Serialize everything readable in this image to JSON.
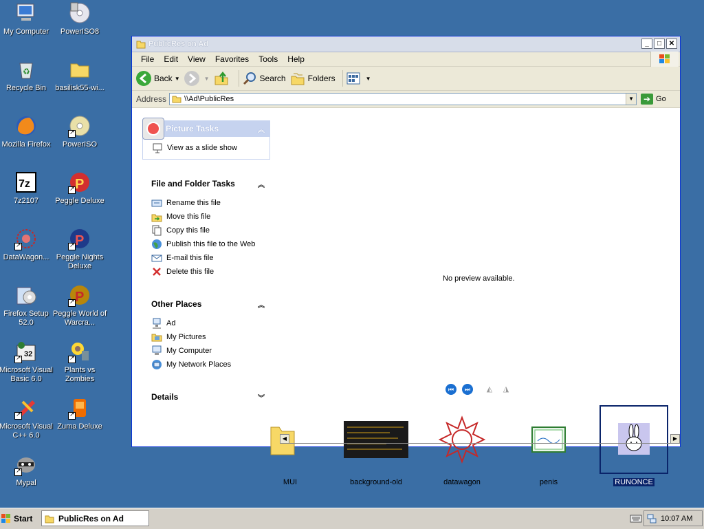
{
  "desktop": {
    "icons": [
      {
        "label": "My Computer",
        "icon": "my-computer-icon"
      },
      {
        "label": "PowerISO8",
        "icon": "poweriso-icon"
      },
      {
        "label": "Recycle Bin",
        "icon": "recycle-bin-icon"
      },
      {
        "label": "basilisk55-wi...",
        "icon": "folder-icon"
      },
      {
        "label": "Mozilla Firefox",
        "icon": "firefox-icon"
      },
      {
        "label": "PowerISO",
        "icon": "poweriso-icon"
      },
      {
        "label": "7z2107",
        "icon": "7zip-icon"
      },
      {
        "label": "Peggle Deluxe",
        "icon": "peggle-icon"
      },
      {
        "label": "DataWagon...",
        "icon": "datawagon-icon"
      },
      {
        "label": "Peggle Nights Deluxe",
        "icon": "peggle-icon"
      },
      {
        "label": "Firefox Setup 52.0",
        "icon": "setup-icon"
      },
      {
        "label": "Peggle World of Warcra...",
        "icon": "peggle-icon"
      },
      {
        "label": "Microsoft Visual Basic 6.0",
        "icon": "vb-icon"
      },
      {
        "label": "Plants vs Zombies",
        "icon": "pvz-icon"
      },
      {
        "label": "Microsoft Visual C++ 6.0",
        "icon": "vc-icon"
      },
      {
        "label": "Zuma Deluxe",
        "icon": "zuma-icon"
      },
      {
        "label": "Mypal",
        "icon": "mypal-icon"
      }
    ]
  },
  "window": {
    "title": "PublicRes on Ad",
    "controls": {
      "minimize": "_",
      "maximize": "□",
      "close": "✕"
    },
    "menu": [
      "File",
      "Edit",
      "View",
      "Favorites",
      "Tools",
      "Help"
    ],
    "toolbar": {
      "back": "Back",
      "search": "Search",
      "folders": "Folders"
    },
    "address": {
      "label": "Address",
      "value": "\\\\Ad\\PublicRes",
      "go": "Go"
    },
    "picture_tasks": {
      "title": "Picture Tasks",
      "items": [
        "View as a slide show"
      ]
    },
    "file_tasks": {
      "title": "File and Folder Tasks",
      "items": [
        "Rename this file",
        "Move this file",
        "Copy this file",
        "Publish this file to the Web",
        "E-mail this file",
        "Delete this file"
      ]
    },
    "other_places": {
      "title": "Other Places",
      "items": [
        "Ad",
        "My Pictures",
        "My Computer",
        "My Network Places"
      ]
    },
    "details": {
      "title": "Details"
    },
    "preview": {
      "message": "No preview available."
    },
    "filmstrip": [
      {
        "name": "MUI",
        "kind": "folder"
      },
      {
        "name": "background-old",
        "kind": "image"
      },
      {
        "name": "datawagon",
        "kind": "image"
      },
      {
        "name": "penis",
        "kind": "image"
      },
      {
        "name": "RUNONCE",
        "kind": "image",
        "selected": true
      }
    ]
  },
  "taskbar": {
    "start": "Start",
    "active_window": "PublicRes on Ad",
    "clock": "10:07 AM"
  },
  "colors": {
    "desktop": "#3a6ea5",
    "selection": "#0a246a"
  }
}
